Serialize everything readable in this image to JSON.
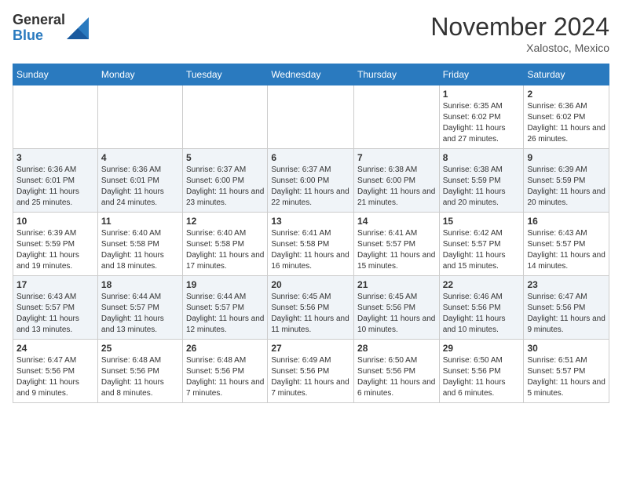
{
  "logo": {
    "general": "General",
    "blue": "Blue"
  },
  "title": "November 2024",
  "location": "Xalostoc, Mexico",
  "days_of_week": [
    "Sunday",
    "Monday",
    "Tuesday",
    "Wednesday",
    "Thursday",
    "Friday",
    "Saturday"
  ],
  "weeks": [
    [
      {
        "day": "",
        "info": ""
      },
      {
        "day": "",
        "info": ""
      },
      {
        "day": "",
        "info": ""
      },
      {
        "day": "",
        "info": ""
      },
      {
        "day": "",
        "info": ""
      },
      {
        "day": "1",
        "info": "Sunrise: 6:35 AM\nSunset: 6:02 PM\nDaylight: 11 hours and 27 minutes."
      },
      {
        "day": "2",
        "info": "Sunrise: 6:36 AM\nSunset: 6:02 PM\nDaylight: 11 hours and 26 minutes."
      }
    ],
    [
      {
        "day": "3",
        "info": "Sunrise: 6:36 AM\nSunset: 6:01 PM\nDaylight: 11 hours and 25 minutes."
      },
      {
        "day": "4",
        "info": "Sunrise: 6:36 AM\nSunset: 6:01 PM\nDaylight: 11 hours and 24 minutes."
      },
      {
        "day": "5",
        "info": "Sunrise: 6:37 AM\nSunset: 6:00 PM\nDaylight: 11 hours and 23 minutes."
      },
      {
        "day": "6",
        "info": "Sunrise: 6:37 AM\nSunset: 6:00 PM\nDaylight: 11 hours and 22 minutes."
      },
      {
        "day": "7",
        "info": "Sunrise: 6:38 AM\nSunset: 6:00 PM\nDaylight: 11 hours and 21 minutes."
      },
      {
        "day": "8",
        "info": "Sunrise: 6:38 AM\nSunset: 5:59 PM\nDaylight: 11 hours and 20 minutes."
      },
      {
        "day": "9",
        "info": "Sunrise: 6:39 AM\nSunset: 5:59 PM\nDaylight: 11 hours and 20 minutes."
      }
    ],
    [
      {
        "day": "10",
        "info": "Sunrise: 6:39 AM\nSunset: 5:59 PM\nDaylight: 11 hours and 19 minutes."
      },
      {
        "day": "11",
        "info": "Sunrise: 6:40 AM\nSunset: 5:58 PM\nDaylight: 11 hours and 18 minutes."
      },
      {
        "day": "12",
        "info": "Sunrise: 6:40 AM\nSunset: 5:58 PM\nDaylight: 11 hours and 17 minutes."
      },
      {
        "day": "13",
        "info": "Sunrise: 6:41 AM\nSunset: 5:58 PM\nDaylight: 11 hours and 16 minutes."
      },
      {
        "day": "14",
        "info": "Sunrise: 6:41 AM\nSunset: 5:57 PM\nDaylight: 11 hours and 15 minutes."
      },
      {
        "day": "15",
        "info": "Sunrise: 6:42 AM\nSunset: 5:57 PM\nDaylight: 11 hours and 15 minutes."
      },
      {
        "day": "16",
        "info": "Sunrise: 6:43 AM\nSunset: 5:57 PM\nDaylight: 11 hours and 14 minutes."
      }
    ],
    [
      {
        "day": "17",
        "info": "Sunrise: 6:43 AM\nSunset: 5:57 PM\nDaylight: 11 hours and 13 minutes."
      },
      {
        "day": "18",
        "info": "Sunrise: 6:44 AM\nSunset: 5:57 PM\nDaylight: 11 hours and 13 minutes."
      },
      {
        "day": "19",
        "info": "Sunrise: 6:44 AM\nSunset: 5:57 PM\nDaylight: 11 hours and 12 minutes."
      },
      {
        "day": "20",
        "info": "Sunrise: 6:45 AM\nSunset: 5:56 PM\nDaylight: 11 hours and 11 minutes."
      },
      {
        "day": "21",
        "info": "Sunrise: 6:45 AM\nSunset: 5:56 PM\nDaylight: 11 hours and 10 minutes."
      },
      {
        "day": "22",
        "info": "Sunrise: 6:46 AM\nSunset: 5:56 PM\nDaylight: 11 hours and 10 minutes."
      },
      {
        "day": "23",
        "info": "Sunrise: 6:47 AM\nSunset: 5:56 PM\nDaylight: 11 hours and 9 minutes."
      }
    ],
    [
      {
        "day": "24",
        "info": "Sunrise: 6:47 AM\nSunset: 5:56 PM\nDaylight: 11 hours and 9 minutes."
      },
      {
        "day": "25",
        "info": "Sunrise: 6:48 AM\nSunset: 5:56 PM\nDaylight: 11 hours and 8 minutes."
      },
      {
        "day": "26",
        "info": "Sunrise: 6:48 AM\nSunset: 5:56 PM\nDaylight: 11 hours and 7 minutes."
      },
      {
        "day": "27",
        "info": "Sunrise: 6:49 AM\nSunset: 5:56 PM\nDaylight: 11 hours and 7 minutes."
      },
      {
        "day": "28",
        "info": "Sunrise: 6:50 AM\nSunset: 5:56 PM\nDaylight: 11 hours and 6 minutes."
      },
      {
        "day": "29",
        "info": "Sunrise: 6:50 AM\nSunset: 5:56 PM\nDaylight: 11 hours and 6 minutes."
      },
      {
        "day": "30",
        "info": "Sunrise: 6:51 AM\nSunset: 5:57 PM\nDaylight: 11 hours and 5 minutes."
      }
    ]
  ]
}
